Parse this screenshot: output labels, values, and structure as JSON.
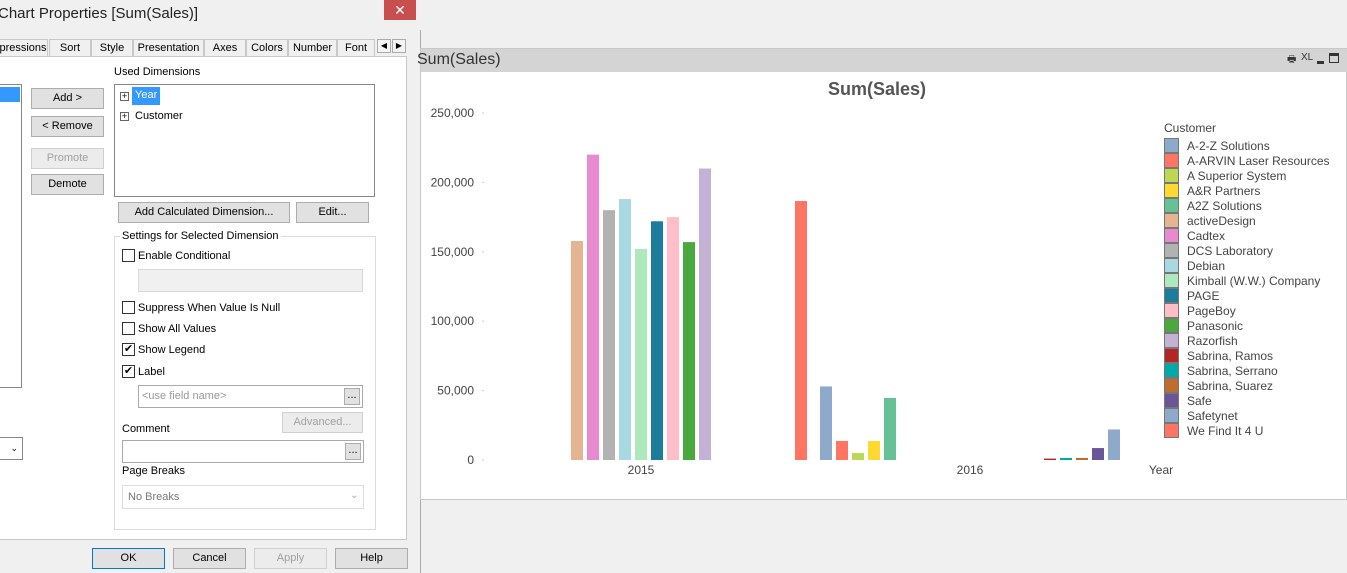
{
  "dialog": {
    "title": "Chart Properties [Sum(Sales)]",
    "tabs": [
      "pressions",
      "Sort",
      "Style",
      "Presentation",
      "Axes",
      "Colors",
      "Number",
      "Font"
    ],
    "used_dimensions_label": "Used Dimensions",
    "used_dimensions": [
      "Year",
      "Customer"
    ],
    "buttons": {
      "add": "Add >",
      "remove": "< Remove",
      "promote": "Promote",
      "demote": "Demote",
      "add_calc": "Add Calculated Dimension...",
      "edit": "Edit...",
      "advanced": "Advanced...",
      "ok": "OK",
      "cancel": "Cancel",
      "apply": "Apply",
      "help": "Help",
      "ellipsis": "..."
    },
    "settings_group": "Settings for Selected Dimension",
    "checkboxes": [
      {
        "label": "Enable Conditional",
        "checked": false
      },
      {
        "label": "Suppress When Value Is Null",
        "checked": false
      },
      {
        "label": "Show All Values",
        "checked": false
      },
      {
        "label": "Show Legend",
        "checked": true
      },
      {
        "label": "Label",
        "checked": true
      }
    ],
    "label_placeholder": "<use field name>",
    "comment_label": "Comment",
    "page_breaks_label": "Page Breaks",
    "page_breaks_value": "No Breaks"
  },
  "chart_object": {
    "caption": "Sum(Sales)",
    "icons": [
      "print-icon",
      "xl-icon",
      "minimize-icon",
      "maximize-icon"
    ],
    "xl_label": "XL"
  },
  "chart_data": {
    "type": "bar",
    "title": "Sum(Sales)",
    "xlabel": "Year",
    "ylabel": "",
    "ylim": [
      0,
      250000
    ],
    "yticks": [
      "0",
      "50,000",
      "100,000",
      "150,000",
      "200,000",
      "250,000"
    ],
    "categories": [
      "2015",
      "2016"
    ],
    "legend_title": "Customer",
    "legend_position": "right",
    "series": [
      {
        "name": "A-2-Z Solutions",
        "color": "#8eaacb",
        "values": [
          null,
          53000
        ]
      },
      {
        "name": "A-ARVIN Laser Resources",
        "color": "#ff7564",
        "values": [
          null,
          13700
        ]
      },
      {
        "name": "A Superior System",
        "color": "#bcd853",
        "values": [
          null,
          5000
        ]
      },
      {
        "name": "A&R Partners",
        "color": "#ffd92f",
        "values": [
          null,
          13700
        ]
      },
      {
        "name": "A2Z Solutions",
        "color": "#66c196",
        "values": [
          null,
          44700
        ]
      },
      {
        "name": "activeDesign",
        "color": "#e5b591",
        "values": [
          157800,
          null
        ]
      },
      {
        "name": "Cadtex",
        "color": "#e78ad0",
        "values": [
          220000,
          null
        ]
      },
      {
        "name": "DCS Laboratory",
        "color": "#b2b2b2",
        "values": [
          180000,
          null
        ]
      },
      {
        "name": "Debian",
        "color": "#a8d8e1",
        "values": [
          188000,
          null
        ]
      },
      {
        "name": "Kimball (W.W.) Company",
        "color": "#ade9bc",
        "values": [
          152000,
          null
        ]
      },
      {
        "name": "PAGE",
        "color": "#1b7d9b",
        "values": [
          172000,
          null
        ]
      },
      {
        "name": "PageBoy",
        "color": "#ffbec8",
        "values": [
          175000,
          null
        ]
      },
      {
        "name": "Panasonic",
        "color": "#4ba83f",
        "values": [
          157000,
          null
        ]
      },
      {
        "name": "Razorfish",
        "color": "#c4b1d6",
        "values": [
          210000,
          null
        ]
      },
      {
        "name": "Sabrina, Ramos",
        "color": "#b32626",
        "values": [
          null,
          1000
        ]
      },
      {
        "name": "Sabrina, Serrano",
        "color": "#00aaa8",
        "values": [
          null,
          1500
        ]
      },
      {
        "name": "Sabrina, Suarez",
        "color": "#bf6c2f",
        "values": [
          null,
          1500
        ]
      },
      {
        "name": "Safe",
        "color": "#6a5597",
        "values": [
          null,
          8600
        ]
      },
      {
        "name": "Safetynet",
        "color": "#8eaacb",
        "values": [
          null,
          22000
        ]
      },
      {
        "name": "We Find It 4 U",
        "color": "#ff7564",
        "values": [
          186600,
          null
        ]
      }
    ]
  }
}
